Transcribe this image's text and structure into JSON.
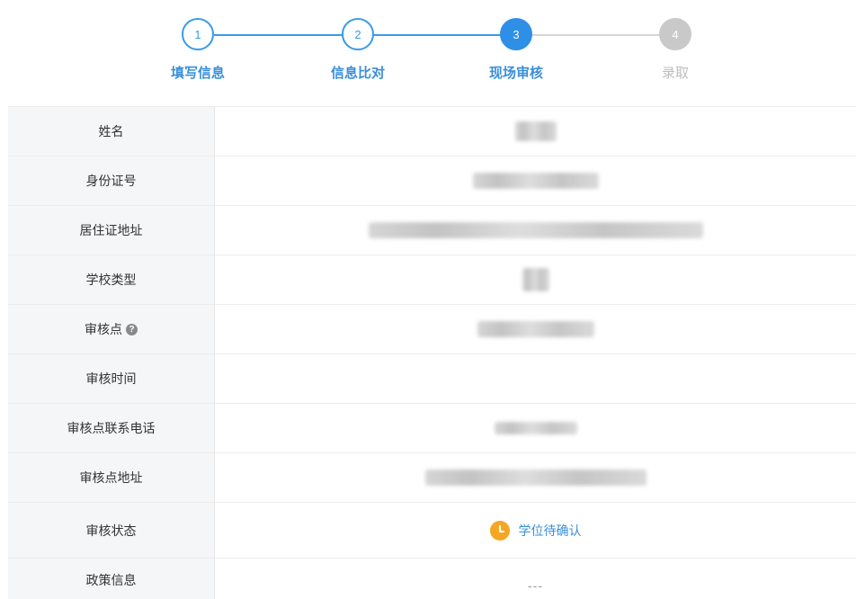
{
  "stepper": {
    "steps": [
      {
        "number": "1",
        "label": "填写信息",
        "state": "done"
      },
      {
        "number": "2",
        "label": "信息比对",
        "state": "done"
      },
      {
        "number": "3",
        "label": "现场审核",
        "state": "active"
      },
      {
        "number": "4",
        "label": "录取",
        "state": "todo"
      }
    ],
    "colors": {
      "done": "#3a9be8",
      "active": "#2e8fe6",
      "todo": "#c9c9c9"
    }
  },
  "table": {
    "rows": [
      {
        "label": "姓名",
        "value": ""
      },
      {
        "label": "身份证号",
        "value": ""
      },
      {
        "label": "居住证地址",
        "value": ""
      },
      {
        "label": "学校类型",
        "value": ""
      },
      {
        "label": "审核点",
        "value": ""
      },
      {
        "label": "审核时间",
        "value": ""
      },
      {
        "label": "审核点联系电话",
        "value": ""
      },
      {
        "label": "审核点地址",
        "value": ""
      },
      {
        "label": "审核状态",
        "value": "学位待确认"
      },
      {
        "label": "政策信息",
        "value": "---"
      }
    ],
    "help_icon_glyph": "?"
  }
}
